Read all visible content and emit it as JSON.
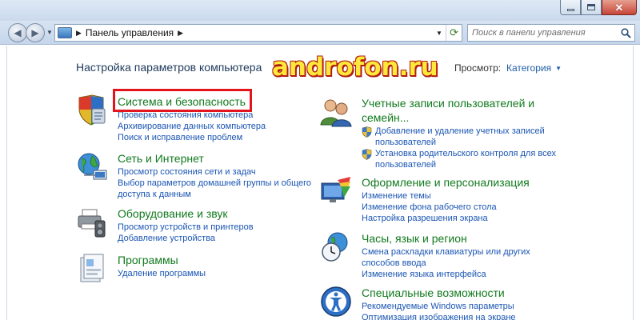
{
  "window": {
    "controls": [
      "minimize",
      "maximize",
      "close"
    ]
  },
  "navigation": {
    "breadcrumb": "Панель управления",
    "search_placeholder": "Поиск в панели управления"
  },
  "header": {
    "title": "Настройка параметров компьютера",
    "view_by_label": "Просмотр:",
    "view_by_value": "Категория"
  },
  "watermark": "androfon.ru",
  "left_categories": [
    {
      "title": "Система и безопасность",
      "icon": "shield-checklist-icon",
      "links": [
        "Проверка состояния компьютера",
        "Архивирование данных компьютера",
        "Поиск и исправление проблем"
      ]
    },
    {
      "title": "Сеть и Интернет",
      "icon": "globe-network-icon",
      "links": [
        "Просмотр состояния сети и задач",
        "Выбор параметров домашней группы и общего",
        "доступа к данным"
      ]
    },
    {
      "title": "Оборудование и звук",
      "icon": "printer-speaker-icon",
      "links": [
        "Просмотр устройств и принтеров",
        "Добавление устройства"
      ]
    },
    {
      "title": "Программы",
      "icon": "programs-icon",
      "links": [
        "Удаление программы"
      ]
    }
  ],
  "right_categories": [
    {
      "title": "Учетные записи пользователей и",
      "title_line2": "семейн...",
      "icon": "users-icon",
      "links": [
        "Добавление и удаление учетных записей",
        "пользователей",
        "Установка родительского контроля для всех",
        "пользователей"
      ]
    },
    {
      "title": "Оформление и персонализация",
      "icon": "personalization-icon",
      "links": [
        "Изменение темы",
        "Изменение фона рабочего стола",
        "Настройка разрешения экрана"
      ]
    },
    {
      "title": "Часы, язык и регион",
      "icon": "clock-globe-icon",
      "links": [
        "Смена раскладки клавиатуры или других",
        "способов ввода",
        "Изменение языка интерфейса"
      ]
    },
    {
      "title": "Специальные возможности",
      "icon": "accessibility-icon",
      "links": [
        "Рекомендуемые Windows параметры",
        "Оптимизация изображения на экране"
      ]
    }
  ],
  "colors": {
    "category_title": "#117a1e",
    "link": "#1a55b3",
    "highlight": "#e3141c",
    "watermark_fill": "#ffe83a",
    "watermark_outline": "#b01c12"
  }
}
